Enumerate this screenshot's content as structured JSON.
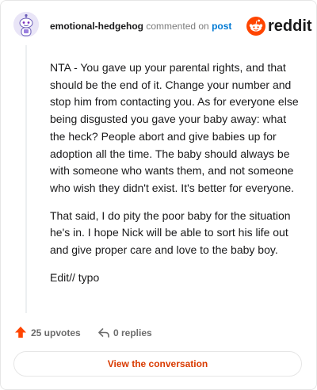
{
  "header": {
    "username": "emotional-hedgehog",
    "action_text": "commented on",
    "post_link": "post",
    "brand": "reddit"
  },
  "comment": {
    "paragraphs": [
      "NTA - You gave up your parental rights, and that should be the end of it. Change your number and stop him from contacting you. As for everyone else being disgusted you gave your baby away: what the heck? People abort and give babies up for adoption all the time. The baby should always be with someone who wants them, and not someone who wish they didn't exist. It's better for everyone.",
      "That said, I do pity the poor baby for the situation he's in. I hope Nick will be able to sort his life out and give proper care and love to the baby boy.",
      "Edit// typo"
    ]
  },
  "actions": {
    "upvotes": "25 upvotes",
    "replies": "0 replies"
  },
  "cta": {
    "label": "View the conversation"
  },
  "icons": {
    "avatar": "snoo-avatar-icon",
    "brand": "reddit-logo-icon",
    "upvote": "upvote-arrow-icon",
    "reply": "reply-arrow-icon"
  },
  "colors": {
    "brand_orange": "#ff4500",
    "link_blue": "#0079d3",
    "cta_text": "#d93a00",
    "upvote_orange": "#ff4500"
  }
}
